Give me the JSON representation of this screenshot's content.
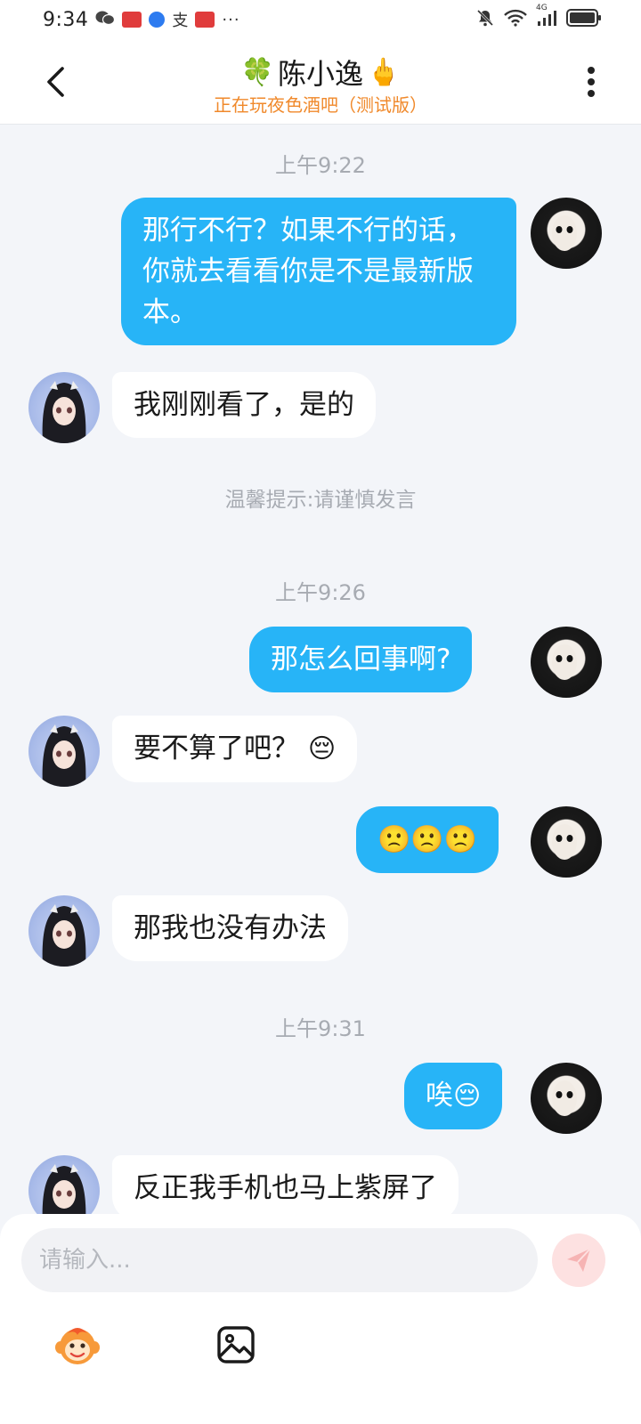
{
  "status_bar": {
    "time": "9:34",
    "misc_text": "支",
    "dots": "···",
    "network": "4G"
  },
  "header": {
    "title": "陈小逸",
    "title_prefix_emoji": "🍀",
    "title_suffix_emoji": "🖕",
    "subtitle": "正在玩夜色酒吧（测试版）"
  },
  "chat": {
    "items": [
      {
        "type": "time",
        "text": "上午9:22"
      },
      {
        "type": "me",
        "text": "那行不行？如果不行的话，你就去看看你是不是最新版本。"
      },
      {
        "type": "other",
        "text": "我刚刚看了，是的"
      },
      {
        "type": "tip",
        "text": "温馨提示:请谨慎发言"
      },
      {
        "type": "time",
        "text": "上午9:26"
      },
      {
        "type": "me",
        "text": "那怎么回事啊?"
      },
      {
        "type": "other",
        "text": "要不算了吧？",
        "emoji": "😔"
      },
      {
        "type": "me",
        "text": "",
        "emoji": "🙁🙁🙁"
      },
      {
        "type": "other",
        "text": "那我也没有办法"
      },
      {
        "type": "time",
        "text": "上午9:31"
      },
      {
        "type": "me",
        "text": "唉",
        "emoji": "😔"
      },
      {
        "type": "other",
        "text": "反正我手机也马上紫屏了"
      }
    ]
  },
  "input": {
    "placeholder": "请输入..."
  },
  "colors": {
    "my_bubble": "#27b4f7",
    "other_bubble": "#ffffff",
    "subtitle": "#f0892b",
    "background": "#f3f5f9"
  },
  "icons": {
    "back": "chevron-left-icon",
    "more": "more-vertical-icon",
    "send": "paper-plane-icon",
    "sticker": "monkey-sticker-icon",
    "image": "image-icon"
  }
}
